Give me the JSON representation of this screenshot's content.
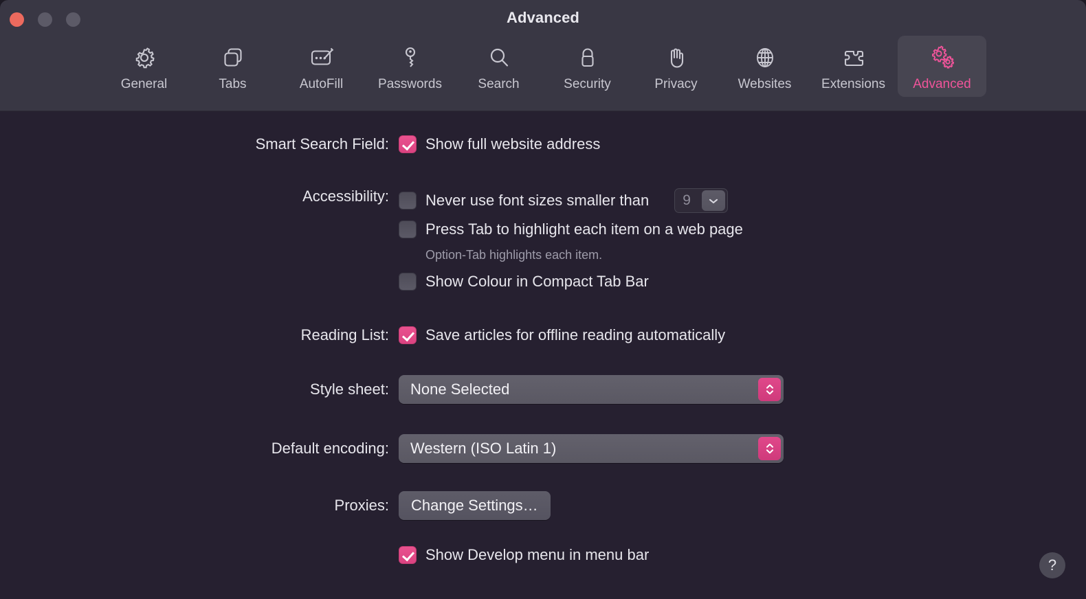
{
  "window": {
    "title": "Advanced",
    "traffic_lights": [
      "close",
      "minimize",
      "zoom"
    ]
  },
  "toolbar": {
    "tabs": [
      {
        "label": "General",
        "icon": "gear-icon",
        "selected": false
      },
      {
        "label": "Tabs",
        "icon": "tabs-icon",
        "selected": false
      },
      {
        "label": "AutoFill",
        "icon": "autofill-icon",
        "selected": false
      },
      {
        "label": "Passwords",
        "icon": "key-icon",
        "selected": false
      },
      {
        "label": "Search",
        "icon": "search-icon",
        "selected": false
      },
      {
        "label": "Security",
        "icon": "lock-icon",
        "selected": false
      },
      {
        "label": "Privacy",
        "icon": "hand-icon",
        "selected": false
      },
      {
        "label": "Websites",
        "icon": "globe-icon",
        "selected": false
      },
      {
        "label": "Extensions",
        "icon": "puzzle-icon",
        "selected": false
      },
      {
        "label": "Advanced",
        "icon": "two-gears-icon",
        "selected": true
      }
    ]
  },
  "settings": {
    "smart_search_field": {
      "label": "Smart Search Field:",
      "checkbox_label": "Show full website address",
      "checked": true
    },
    "accessibility": {
      "label": "Accessibility:",
      "min_font": {
        "checkbox_label": "Never use font sizes smaller than",
        "checked": false,
        "value": "9"
      },
      "tab_highlight": {
        "checkbox_label": "Press Tab to highlight each item on a web page",
        "checked": false,
        "hint": "Option-Tab highlights each item."
      },
      "compact_tab_colour": {
        "checkbox_label": "Show Colour in Compact Tab Bar",
        "checked": false
      }
    },
    "reading_list": {
      "label": "Reading List:",
      "checkbox_label": "Save articles for offline reading automatically",
      "checked": true
    },
    "style_sheet": {
      "label": "Style sheet:",
      "selected": "None Selected"
    },
    "default_encoding": {
      "label": "Default encoding:",
      "selected": "Western (ISO Latin 1)"
    },
    "proxies": {
      "label": "Proxies:",
      "button_label": "Change Settings…"
    },
    "develop_menu": {
      "checkbox_label": "Show Develop menu in menu bar",
      "checked": true
    }
  },
  "help_button": {
    "glyph": "?"
  },
  "colors": {
    "accent_pink": "#e9528f",
    "titlebar_bg": "#393744",
    "content_bg": "#262030",
    "selected_tab_bg": "#474551",
    "close_red": "#ec6a5e",
    "control_gray": "#5d5b67",
    "text_primary": "#e7e6ec",
    "text_secondary": "#9e9caa"
  }
}
